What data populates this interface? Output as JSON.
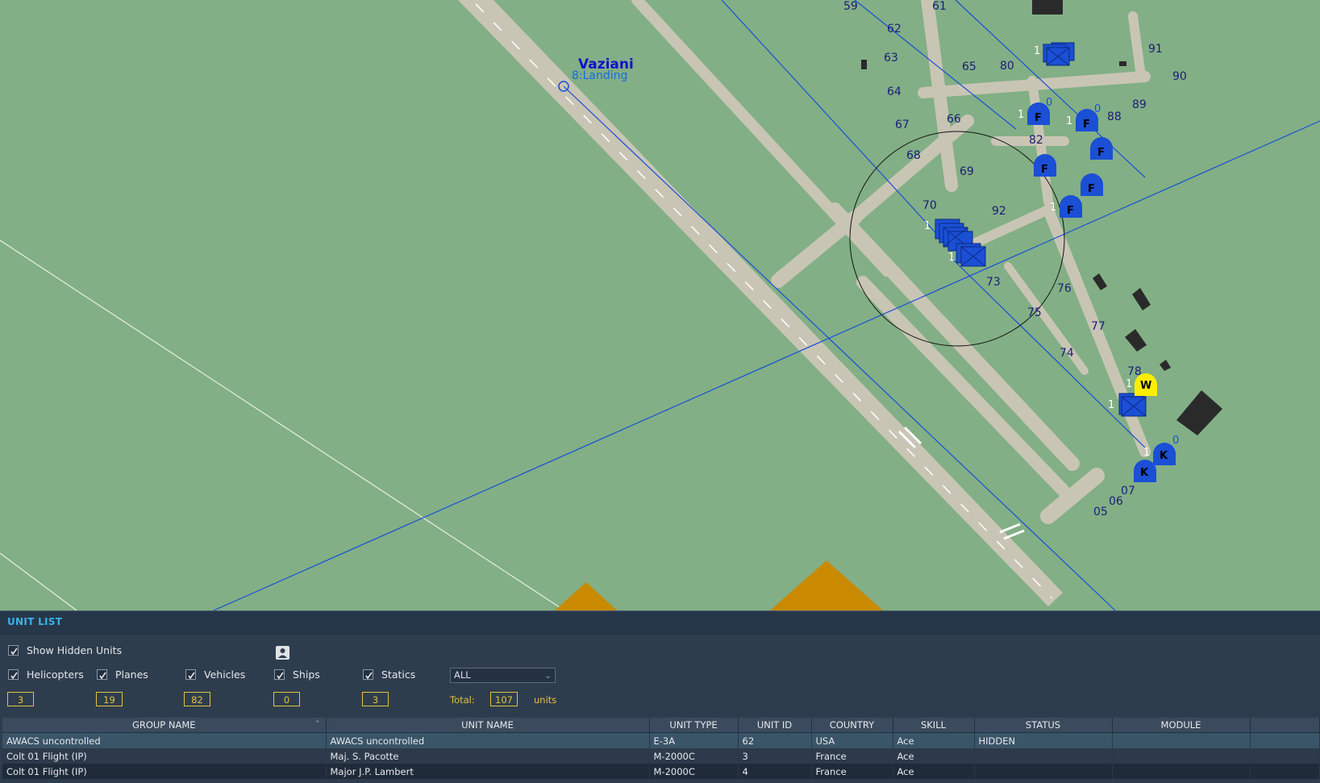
{
  "map": {
    "airfield_name": "Vaziani",
    "waypoint_label": "8:Landing",
    "parking_numbers": [
      "59",
      "61",
      "62",
      "63",
      "64",
      "65",
      "80",
      "91",
      "90",
      "89",
      "88",
      "67",
      "66",
      "82",
      "68",
      "69",
      "70",
      "92",
      "73",
      "76",
      "75",
      "77",
      "74",
      "78",
      "07",
      "06",
      "05"
    ],
    "unit_letters": [
      "F",
      "F",
      "F",
      "F",
      "F",
      "F",
      "W",
      "K",
      "K"
    ],
    "group_counts": [
      "1",
      "1",
      "0",
      "1",
      "0",
      "1",
      "1",
      "1",
      "1",
      "1",
      "0",
      "1"
    ],
    "colors": {
      "blue_unit": "#1a4fd6",
      "yellow_unit": "#ffee00",
      "grass": "#82af85",
      "runway": "#c9c5b5",
      "structures": "#2a2a2a",
      "threat_zone": "#c98a00"
    }
  },
  "unit_list": {
    "title": "UNIT LIST",
    "show_hidden_label": "Show Hidden Units",
    "filters": [
      {
        "label": "Helicopters",
        "count": "3",
        "checked": true
      },
      {
        "label": "Planes",
        "count": "19",
        "checked": true
      },
      {
        "label": "Vehicles",
        "count": "82",
        "checked": true
      },
      {
        "label": "Ships",
        "count": "0",
        "checked": true
      },
      {
        "label": "Statics",
        "count": "3",
        "checked": true
      }
    ],
    "country_select": "ALL",
    "total_label": "Total:",
    "total_value": "107",
    "units_label": "units",
    "columns": [
      "GROUP NAME",
      "UNIT NAME",
      "UNIT TYPE",
      "UNIT ID",
      "COUNTRY",
      "SKILL",
      "STATUS",
      "MODULE"
    ],
    "rows": [
      [
        "AWACS uncontrolled",
        "AWACS uncontrolled",
        "E-3A",
        "62",
        "USA",
        "Ace",
        "HIDDEN",
        ""
      ],
      [
        "Colt 01 Flight (IP)",
        "Maj. S. Pacotte",
        "M-2000C",
        "3",
        "France",
        "Ace",
        "",
        ""
      ],
      [
        "Colt 01 Flight (IP)",
        "Major J.P. Lambert",
        "M-2000C",
        "4",
        "France",
        "Ace",
        "",
        ""
      ]
    ]
  }
}
